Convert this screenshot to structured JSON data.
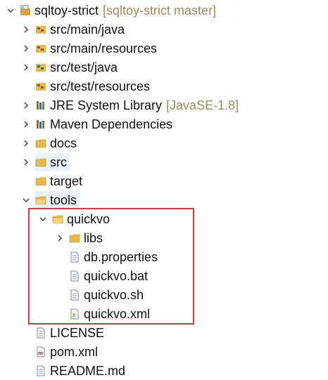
{
  "project": {
    "name": "sqltoy-strict",
    "decoration": "[sqltoy-strict master]"
  },
  "items": [
    {
      "label": "src/main/java"
    },
    {
      "label": "src/main/resources"
    },
    {
      "label": "src/test/java"
    },
    {
      "label": "src/test/resources"
    },
    {
      "label": "JRE System Library",
      "decoration": "[JavaSE-1.8]"
    },
    {
      "label": "Maven Dependencies"
    },
    {
      "label": "docs"
    },
    {
      "label": "src"
    },
    {
      "label": "target"
    },
    {
      "label": "tools"
    },
    {
      "label": "quickvo"
    },
    {
      "label": "libs"
    },
    {
      "label": "db.properties"
    },
    {
      "label": "quickvo.bat"
    },
    {
      "label": "quickvo.sh"
    },
    {
      "label": "quickvo.xml"
    },
    {
      "label": "LICENSE"
    },
    {
      "label": "pom.xml"
    },
    {
      "label": "README.md"
    }
  ],
  "colors": {
    "highlight_border": "#e0353b",
    "decoration_text": "#a08a5a",
    "folder": "#e9b84a"
  }
}
